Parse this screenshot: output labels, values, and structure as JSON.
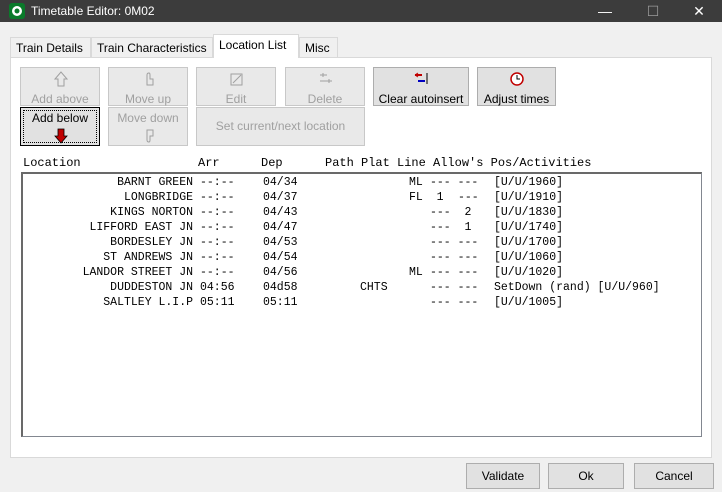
{
  "window": {
    "title": "Timetable Editor: 0M02",
    "minimize_glyph": "—",
    "maximize_glyph": "☐",
    "close_glyph": "✕"
  },
  "tabs": [
    {
      "label": "Train Details",
      "active": false
    },
    {
      "label": "Train Characteristics",
      "active": false
    },
    {
      "label": "Location List",
      "active": true
    },
    {
      "label": "Misc",
      "active": false
    }
  ],
  "toolbar": {
    "add_above": "Add above",
    "move_up": "Move up",
    "edit": "Edit",
    "delete": "Delete",
    "clear_autoinsert": "Clear autoinsert",
    "adjust_times": "Adjust times",
    "add_below": "Add below",
    "move_down": "Move down",
    "set_current_next": "Set current/next location"
  },
  "columns": {
    "location": "Location",
    "arr": "Arr",
    "dep": "Dep",
    "path_plat_line": "Path Plat Line Allow's Pos/Activities"
  },
  "rows": [
    {
      "location": "BARNT GREEN",
      "arr": "--:--",
      "dep": "04/34",
      "path": "",
      "line": "ML",
      "allow": "--- ---",
      "pos": "[U/U/1960]"
    },
    {
      "location": "LONGBRIDGE",
      "arr": "--:--",
      "dep": "04/37",
      "path": "",
      "line": "FL  1",
      "allow": "---",
      "pos": "[U/U/1910]"
    },
    {
      "location": "KINGS NORTON",
      "arr": "--:--",
      "dep": "04/43",
      "path": "",
      "line": "",
      "allow": "---  2",
      "pos": "[U/U/1830]"
    },
    {
      "location": "LIFFORD EAST JN",
      "arr": "--:--",
      "dep": "04/47",
      "path": "",
      "line": "",
      "allow": "---  1",
      "pos": "[U/U/1740]"
    },
    {
      "location": "BORDESLEY JN",
      "arr": "--:--",
      "dep": "04/53",
      "path": "",
      "line": "",
      "allow": "--- ---",
      "pos": "[U/U/1700]"
    },
    {
      "location": "ST ANDREWS JN",
      "arr": "--:--",
      "dep": "04/54",
      "path": "",
      "line": "",
      "allow": "--- ---",
      "pos": "[U/U/1060]"
    },
    {
      "location": "LANDOR STREET JN",
      "arr": "--:--",
      "dep": "04/56",
      "path": "",
      "line": "ML",
      "allow": "--- ---",
      "pos": "[U/U/1020]"
    },
    {
      "location": "DUDDESTON JN",
      "arr": "04:56",
      "dep": "04d58",
      "path": "CHTS",
      "line": "",
      "allow": "--- ---",
      "pos": "SetDown (rand) [U/U/960]"
    },
    {
      "location": "SALTLEY L.I.P",
      "arr": "05:11",
      "dep": "05:11",
      "path": "",
      "line": "",
      "allow": "--- ---",
      "pos": "[U/U/1005]"
    }
  ],
  "dialog": {
    "validate": "Validate",
    "ok": "Ok",
    "cancel": "Cancel"
  }
}
